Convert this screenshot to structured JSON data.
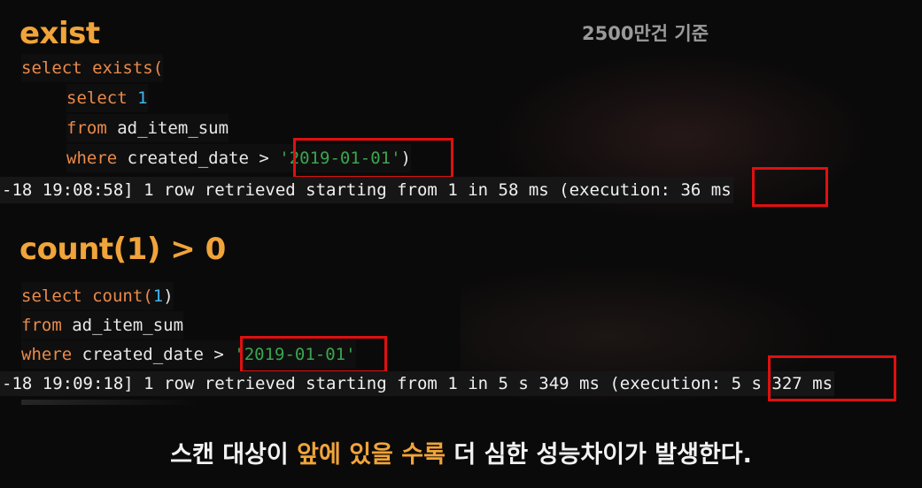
{
  "headings": {
    "first": "exist",
    "second": "count(1) > 0"
  },
  "note": "2500만건 기준",
  "block1": {
    "line1_kw1": "select",
    "line1_fn": "exists(",
    "line2_kw": "select",
    "line2_num": "1",
    "line3_kw": "from",
    "line3_rest": "ad_item_sum",
    "line4_kw": "where",
    "line4_rest": "created_date >",
    "line4_str": "'2019-01-01'",
    "line4_close": ")",
    "log_main": "-18 19:08:58] 1 row retrieved starting from 1 in 58 ms (execution:",
    "log_exec": "36 ms"
  },
  "block2": {
    "line1_kw": "select",
    "line1_fn": "count(",
    "line1_num": "1",
    "line1_close": ")",
    "line2_kw": "from",
    "line2_rest": "ad_item_sum",
    "line3_kw": "where",
    "line3_rest": "created_date >",
    "line3_str": "'2019-01-01'",
    "log_main": "-18 19:09:18] 1 row retrieved starting from 1 in 5 s 349 ms (execution:",
    "log_exec": "5 s 327 ms"
  },
  "caption": {
    "part1": "스캔 대상이 ",
    "highlight": "앞에 있을 수록",
    "part2": " 더 심한 성능차이가 발생한다."
  },
  "colors": {
    "heading": "#f0a43a",
    "keyword": "#e98a4a",
    "number": "#3fb6ef",
    "string": "#3aa550",
    "highlight_box": "#e01010"
  }
}
